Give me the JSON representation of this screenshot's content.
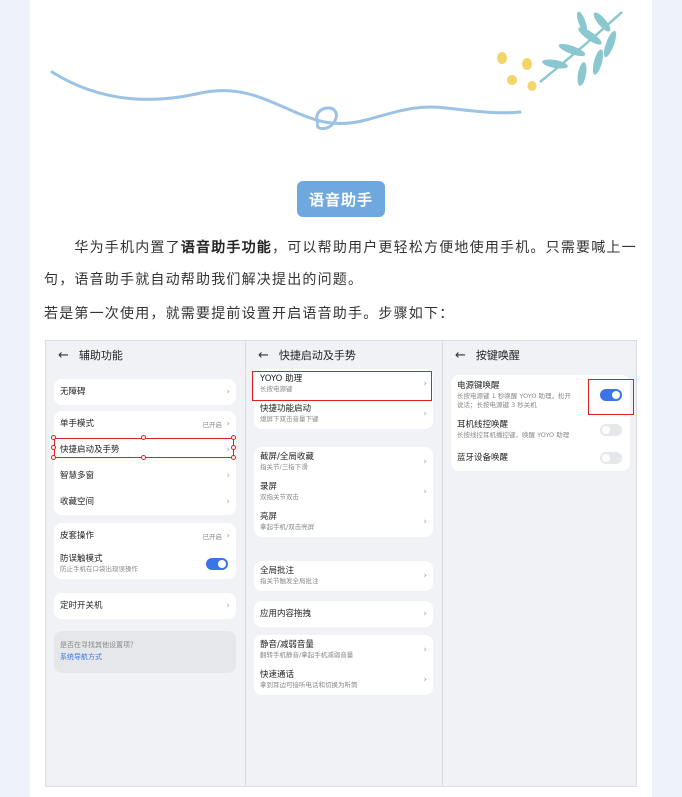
{
  "colors": {
    "accent_blue": "#6fa8de",
    "toggle_blue": "#3b74e6",
    "highlight_red": "#e02020",
    "page_side": "#eef3fb"
  },
  "heading": "语音助手",
  "para1_pre": "华为手机内置了",
  "para1_bold": "语音助手功能",
  "para1_post": "，可以帮助用户更轻松方便地使用手机。只需要喊上一句，语音助手就自动帮助我们解决提出的问题。",
  "para2": "若是第一次使用，就需要提前设置开启语音助手。步骤如下：",
  "panel1": {
    "title": "辅助功能",
    "items": [
      {
        "label": "无障碍"
      },
      {
        "label": "单手模式",
        "status": "已开启"
      },
      {
        "label": "快捷启动及手势"
      },
      {
        "label": "智慧多窗"
      },
      {
        "label": "收藏空间"
      },
      {
        "label": "皮套操作",
        "status": "已开启"
      },
      {
        "label": "防误触模式",
        "sub": "防止手机在口袋出现误操作"
      },
      {
        "label": "定时开关机"
      }
    ],
    "hint_q": "是否在寻找其他设置项？",
    "hint_link": "系统导航方式"
  },
  "panel2": {
    "title": "快捷启动及手势",
    "items": [
      {
        "label": "YOYO 助理",
        "sub": "长按电源键"
      },
      {
        "label": "快捷功能启动",
        "sub": "熄屏下双击音量下键"
      },
      {
        "label": "截屏/全局收藏",
        "sub": "指关节/三指下滑"
      },
      {
        "label": "录屏",
        "sub": "双指关节双击"
      },
      {
        "label": "亮屏",
        "sub": "拿起手机/双击亮屏"
      },
      {
        "label": "全局批注",
        "sub": "指关节触发全局批注"
      },
      {
        "label": "应用内容拖拽"
      },
      {
        "label": "静音/减弱音量",
        "sub": "翻转手机静音/拿起手机减弱音量"
      },
      {
        "label": "快速通话",
        "sub": "拿到耳边可接听电话和切换为听筒"
      }
    ]
  },
  "panel3": {
    "title": "按键唤醒",
    "items": [
      {
        "label": "电源键唤醒",
        "sub1": "长按电源键 1 秒唤醒 YOYO 助理，松开",
        "sub2": "说话；长按电源键 3 秒关机",
        "toggle": "on"
      },
      {
        "label": "耳机线控唤醒",
        "sub1": "长按线控耳机播控键，唤醒 YOYO 助理",
        "toggle": "off"
      },
      {
        "label": "蓝牙设备唤醒",
        "toggle": "off"
      }
    ]
  }
}
